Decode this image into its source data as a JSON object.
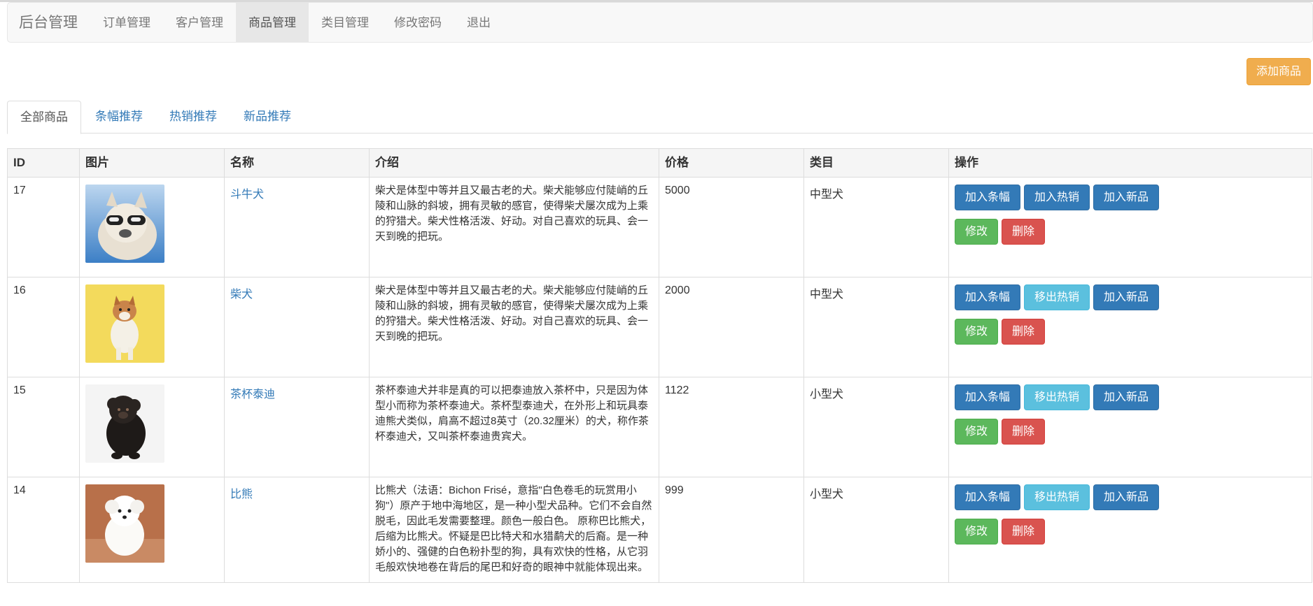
{
  "navbar": {
    "brand": "后台管理",
    "items": [
      "订单管理",
      "客户管理",
      "商品管理",
      "类目管理",
      "修改密码",
      "退出"
    ]
  },
  "add_button": "添加商品",
  "tabs": [
    "全部商品",
    "条幅推荐",
    "热销推荐",
    "新品推荐"
  ],
  "table": {
    "headers": [
      "ID",
      "图片",
      "名称",
      "介绍",
      "价格",
      "类目",
      "操作"
    ],
    "rows": [
      {
        "id": "17",
        "name": "斗牛犬",
        "desc": "柴犬是体型中等并且又最古老的犬。柴犬能够应付陡峭的丘陵和山脉的斜坡，拥有灵敏的感官，使得柴犬屡次成为上乘的狩猎犬。柴犬性格活泼、好动。对自己喜欢的玩具、会一天到晚的把玩。",
        "price": "5000",
        "category": "中型犬",
        "btn_banner": "加入条幅",
        "btn_hot": "加入热销",
        "btn_new": "加入新品",
        "btn_edit": "修改",
        "btn_delete": "删除",
        "image": "dog-with-goggles"
      },
      {
        "id": "16",
        "name": "柴犬",
        "desc": "柴犬是体型中等并且又最古老的犬。柴犬能够应付陡峭的丘陵和山脉的斜坡，拥有灵敏的感官，使得柴犬屡次成为上乘的狩猎犬。柴犬性格活泼、好动。对自己喜欢的玩具、会一天到晚的把玩。",
        "price": "2000",
        "category": "中型犬",
        "btn_banner": "加入条幅",
        "btn_hot": "移出热销",
        "btn_new": "加入新品",
        "btn_edit": "修改",
        "btn_delete": "删除",
        "image": "shiba-puppy"
      },
      {
        "id": "15",
        "name": "茶杯泰迪",
        "desc": "茶杯泰迪犬并非是真的可以把泰迪放入茶杯中，只是因为体型小而称为茶杯泰迪犬。茶杯型泰迪犬，在外形上和玩具泰迪熊犬类似，肩高不超过8英寸（20.32厘米）的犬，称作茶杯泰迪犬，又叫茶杯泰迪贵宾犬。",
        "price": "1122",
        "category": "小型犬",
        "btn_banner": "加入条幅",
        "btn_hot": "移出热销",
        "btn_new": "加入新品",
        "btn_edit": "修改",
        "btn_delete": "删除",
        "image": "black-poodle"
      },
      {
        "id": "14",
        "name": "比熊",
        "desc": "比熊犬（法语：Bichon Frisé，意指\"白色卷毛的玩赏用小狗\"）原产于地中海地区，是一种小型犬品种。它们不会自然脱毛，因此毛发需要整理。颜色一般白色。 原称巴比熊犬，后缩为比熊犬。怀疑是巴比特犬和水猎鹬犬的后裔。是一种娇小的、强健的白色粉扑型的狗，具有欢快的性格，从它羽毛般欢快地卷在背后的尾巴和好奇的眼神中就能体现出来。",
        "price": "999",
        "category": "小型犬",
        "btn_banner": "加入条幅",
        "btn_hot": "移出热销",
        "btn_new": "加入新品",
        "btn_edit": "修改",
        "btn_delete": "删除",
        "image": "white-bichon"
      }
    ]
  }
}
